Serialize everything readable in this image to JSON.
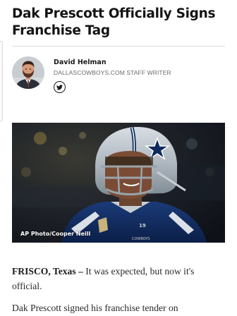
{
  "article": {
    "headline": "Dak Prescott Officially Signs Franchise Tag",
    "dateline": "FRISCO, Texas –",
    "paragraph1": " It was expected, but now it's official.",
    "paragraph2": "Dak Prescott signed his franchise tender on"
  },
  "author": {
    "name": "David Helman",
    "title": "DALLASCOWBOYS.COM STAFF WRITER",
    "social_icon": "twitter-icon"
  },
  "image": {
    "credit": "AP Photo/Cooper Neill"
  },
  "colors": {
    "text": "#1a1a1a",
    "muted": "#6b6b6b",
    "cowboys_navy": "#0d2a5c",
    "cowboys_silver": "#b0b7bc"
  }
}
